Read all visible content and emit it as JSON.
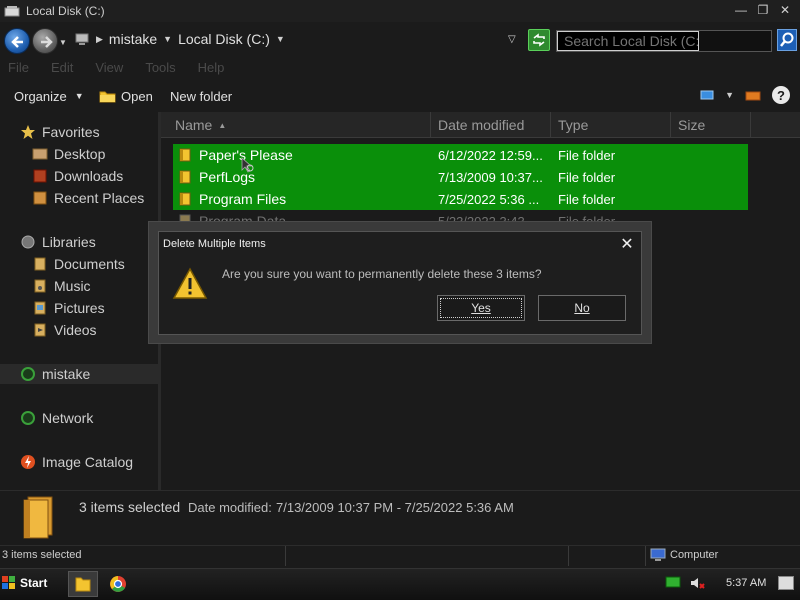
{
  "window": {
    "title": "Local Disk (C:)"
  },
  "address": {
    "crumbs": [
      "mistake",
      "Local Disk (C:)"
    ]
  },
  "search": {
    "placeholder": "Search Local Disk (C:)"
  },
  "menu": [
    "File",
    "Edit",
    "View",
    "Tools",
    "Help"
  ],
  "toolbar": {
    "organize": "Organize",
    "open": "Open",
    "new_folder": "New folder"
  },
  "nav": {
    "favorites": "Favorites",
    "desktop": "Desktop",
    "downloads": "Downloads",
    "recent_places": "Recent Places",
    "libraries": "Libraries",
    "documents": "Documents",
    "music": "Music",
    "pictures": "Pictures",
    "videos": "Videos",
    "computer": "mistake",
    "network": "Network",
    "image_catalog": "Image Catalog"
  },
  "columns": {
    "name": "Name",
    "date": "Date modified",
    "type": "Type",
    "size": "Size"
  },
  "files": [
    {
      "name": "Paper's Please",
      "date": "6/12/2022 12:59...",
      "type": "File folder",
      "selected": true
    },
    {
      "name": "PerfLogs",
      "date": "7/13/2009 10:37...",
      "type": "File folder",
      "selected": true
    },
    {
      "name": "Program Files",
      "date": "7/25/2022 5:36 ...",
      "type": "File folder",
      "selected": true
    },
    {
      "name": "Program Data",
      "date": "5/23/2022 3:43 ...",
      "type": "File folder",
      "selected": false
    }
  ],
  "details": {
    "count": "3 items selected",
    "label": "Date modified:",
    "value": "7/13/2009 10:37 PM - 7/25/2022 5:36 AM"
  },
  "status": {
    "left": "3 items selected",
    "right": "Computer"
  },
  "dialog": {
    "title": "Delete Multiple Items",
    "message": "Are you sure you want to permanently delete these 3 items?",
    "yes": "Yes",
    "no": "No"
  },
  "taskbar": {
    "start": "Start",
    "clock": "5:37 AM"
  },
  "colors": {
    "selection": "#0a8f0a",
    "background": "#1b1b1b",
    "accent_blue": "#1f5fb0"
  },
  "icons": {
    "back": "back-arrow-icon",
    "forward": "forward-arrow-icon",
    "refresh": "refresh-icon",
    "search": "search-icon",
    "help": "help-icon",
    "folder": "folder-icon",
    "warning": "warning-icon"
  }
}
